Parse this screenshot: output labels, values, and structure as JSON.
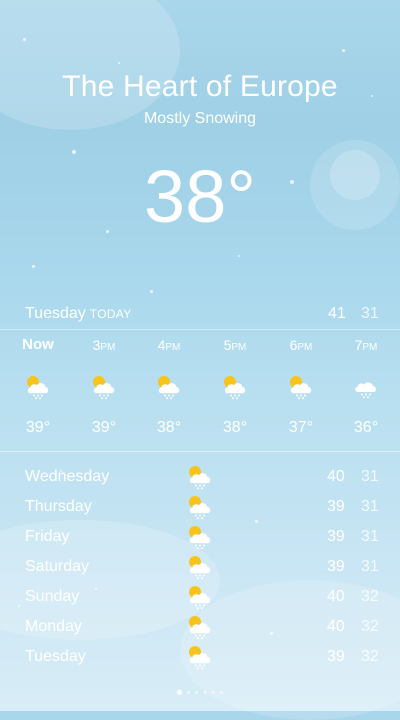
{
  "location": {
    "city": "The Heart of Europe",
    "condition": "Mostly Snowing",
    "current_temp": "38°"
  },
  "today": {
    "day": "Tuesday",
    "tag": "TODAY",
    "high": "41",
    "low": "31"
  },
  "hourly": [
    {
      "time": "Now",
      "suffix": "",
      "icon": "cloud-sun-snow-icon",
      "temp": "39°"
    },
    {
      "time": "3",
      "suffix": "PM",
      "icon": "cloud-sun-snow-icon",
      "temp": "39°"
    },
    {
      "time": "4",
      "suffix": "PM",
      "icon": "cloud-sun-snow-icon",
      "temp": "38°"
    },
    {
      "time": "5",
      "suffix": "PM",
      "icon": "cloud-sun-snow-icon",
      "temp": "38°"
    },
    {
      "time": "6",
      "suffix": "PM",
      "icon": "cloud-sun-snow-icon",
      "temp": "37°"
    },
    {
      "time": "7",
      "suffix": "PM",
      "icon": "cloud-snow-icon",
      "temp": "36°"
    }
  ],
  "daily": [
    {
      "day": "Wednesday",
      "icon": "cloud-sun-snow-icon",
      "high": "40",
      "low": "31"
    },
    {
      "day": "Thursday",
      "icon": "cloud-sun-snow-icon",
      "high": "39",
      "low": "31"
    },
    {
      "day": "Friday",
      "icon": "cloud-sun-snow-icon",
      "high": "39",
      "low": "31"
    },
    {
      "day": "Saturday",
      "icon": "cloud-sun-snow-icon",
      "high": "39",
      "low": "31"
    },
    {
      "day": "Sunday",
      "icon": "cloud-sun-snow-icon",
      "high": "40",
      "low": "32"
    },
    {
      "day": "Monday",
      "icon": "cloud-sun-snow-icon",
      "high": "40",
      "low": "32"
    },
    {
      "day": "Tuesday",
      "icon": "cloud-sun-snow-icon",
      "high": "39",
      "low": "32"
    }
  ],
  "colors": {
    "text": "#ffffff",
    "sun": "#f7c41b",
    "sky_top": "#a9d6ea",
    "sky_bottom": "#d8edf7"
  },
  "pages": {
    "count": 6,
    "current_is_location": true
  }
}
